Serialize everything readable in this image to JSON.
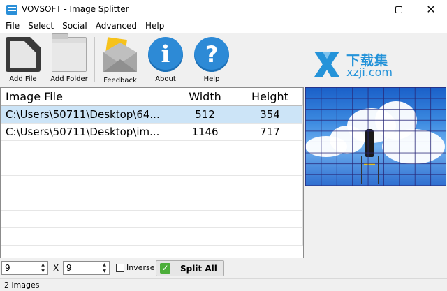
{
  "window": {
    "title": "VOVSOFT - Image Splitter"
  },
  "menu": [
    "File",
    "Select",
    "Social",
    "Advanced",
    "Help"
  ],
  "toolbar": {
    "add_file": "Add File",
    "add_folder": "Add Folder",
    "feedback": "Feedback",
    "about": "About",
    "help": "Help"
  },
  "watermark": {
    "cn": "下载集",
    "en": "xzji.com"
  },
  "table": {
    "headers": [
      "Image File",
      "Width",
      "Height"
    ],
    "rows": [
      {
        "file": "C:\\Users\\50711\\Desktop\\64...",
        "width": "512",
        "height": "354",
        "selected": true
      },
      {
        "file": "C:\\Users\\50711\\Desktop\\im...",
        "width": "1146",
        "height": "717",
        "selected": false
      }
    ]
  },
  "controls": {
    "cols_value": "9",
    "rows_value": "9",
    "x_label": "X",
    "inverse_label": "Inverse",
    "split_all_label": "Split All"
  },
  "status": {
    "text": "2 images"
  },
  "colors": {
    "selection": "#cce4f7",
    "icon_blue": "#2d8ad6",
    "split_green": "#4cae3a"
  }
}
